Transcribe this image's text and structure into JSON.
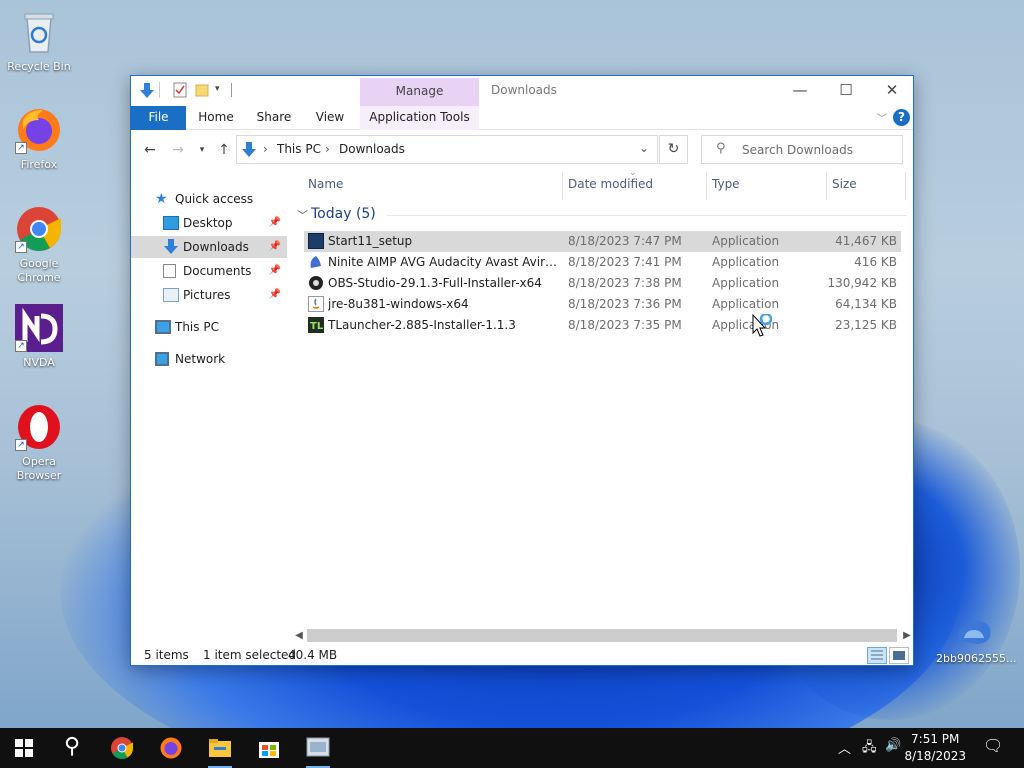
{
  "desktop": {
    "icons": [
      {
        "label": "Recycle Bin",
        "icon": "recycle-bin-icon"
      },
      {
        "label": "Firefox",
        "icon": "firefox-icon"
      },
      {
        "label": "Google Chrome",
        "icon": "chrome-icon"
      },
      {
        "label": "NVDA",
        "icon": "nvda-icon"
      },
      {
        "label": "Opera Browser",
        "icon": "opera-icon"
      },
      {
        "label": "2bb9062555...",
        "icon": "file-icon"
      }
    ]
  },
  "window": {
    "title": "Downloads",
    "contextual_tab": "Manage",
    "ribbon_tabs": [
      "File",
      "Home",
      "Share",
      "View",
      "Application Tools"
    ],
    "address": {
      "crumbs": [
        "This PC",
        "Downloads"
      ]
    },
    "search_placeholder": "Search Downloads",
    "nav_pane": {
      "items": [
        {
          "label": "Quick access",
          "icon": "star-icon",
          "pinned": false
        },
        {
          "label": "Desktop",
          "icon": "desktop-folder-icon",
          "pinned": true
        },
        {
          "label": "Downloads",
          "icon": "downloads-folder-icon",
          "pinned": true,
          "selected": true
        },
        {
          "label": "Documents",
          "icon": "documents-folder-icon",
          "pinned": true
        },
        {
          "label": "Pictures",
          "icon": "pictures-folder-icon",
          "pinned": true
        },
        {
          "label": "This PC",
          "icon": "computer-icon",
          "pinned": false
        },
        {
          "label": "Network",
          "icon": "network-icon",
          "pinned": false
        }
      ]
    },
    "columns": [
      "Name",
      "Date modified",
      "Type",
      "Size"
    ],
    "group": {
      "label": "Today (5)"
    },
    "files": [
      {
        "name": "Start11_setup",
        "date": "8/18/2023 7:47 PM",
        "type": "Application",
        "size": "41,467 KB",
        "selected": true,
        "icon": "start11-icon"
      },
      {
        "name": "Ninite AIMP AVG Audacity Avast Avira Bl...",
        "date": "8/18/2023 7:41 PM",
        "type": "Application",
        "size": "416 KB",
        "selected": false,
        "icon": "ninite-icon"
      },
      {
        "name": "OBS-Studio-29.1.3-Full-Installer-x64",
        "date": "8/18/2023 7:38 PM",
        "type": "Application",
        "size": "130,942 KB",
        "selected": false,
        "icon": "obs-icon"
      },
      {
        "name": "jre-8u381-windows-x64",
        "date": "8/18/2023 7:36 PM",
        "type": "Application",
        "size": "64,134 KB",
        "selected": false,
        "icon": "java-icon"
      },
      {
        "name": "TLauncher-2.885-Installer-1.1.3",
        "date": "8/18/2023 7:35 PM",
        "type": "Application",
        "size": "23,125 KB",
        "selected": false,
        "icon": "tlauncher-icon"
      }
    ],
    "status": {
      "count": "5 items",
      "selection": "1 item selected",
      "size": "40.4 MB"
    }
  },
  "taskbar": {
    "time": "7:51 PM",
    "date": "8/18/2023",
    "apps": [
      "start-icon",
      "search-icon",
      "chrome-icon",
      "firefox-icon",
      "file-explorer-icon",
      "store-icon",
      "app-icon"
    ]
  },
  "colors": {
    "accent": "#1a6fc4",
    "manage_tab": "#e8d3f5",
    "selection": "#d9d9d9",
    "taskbar": "#101010"
  }
}
